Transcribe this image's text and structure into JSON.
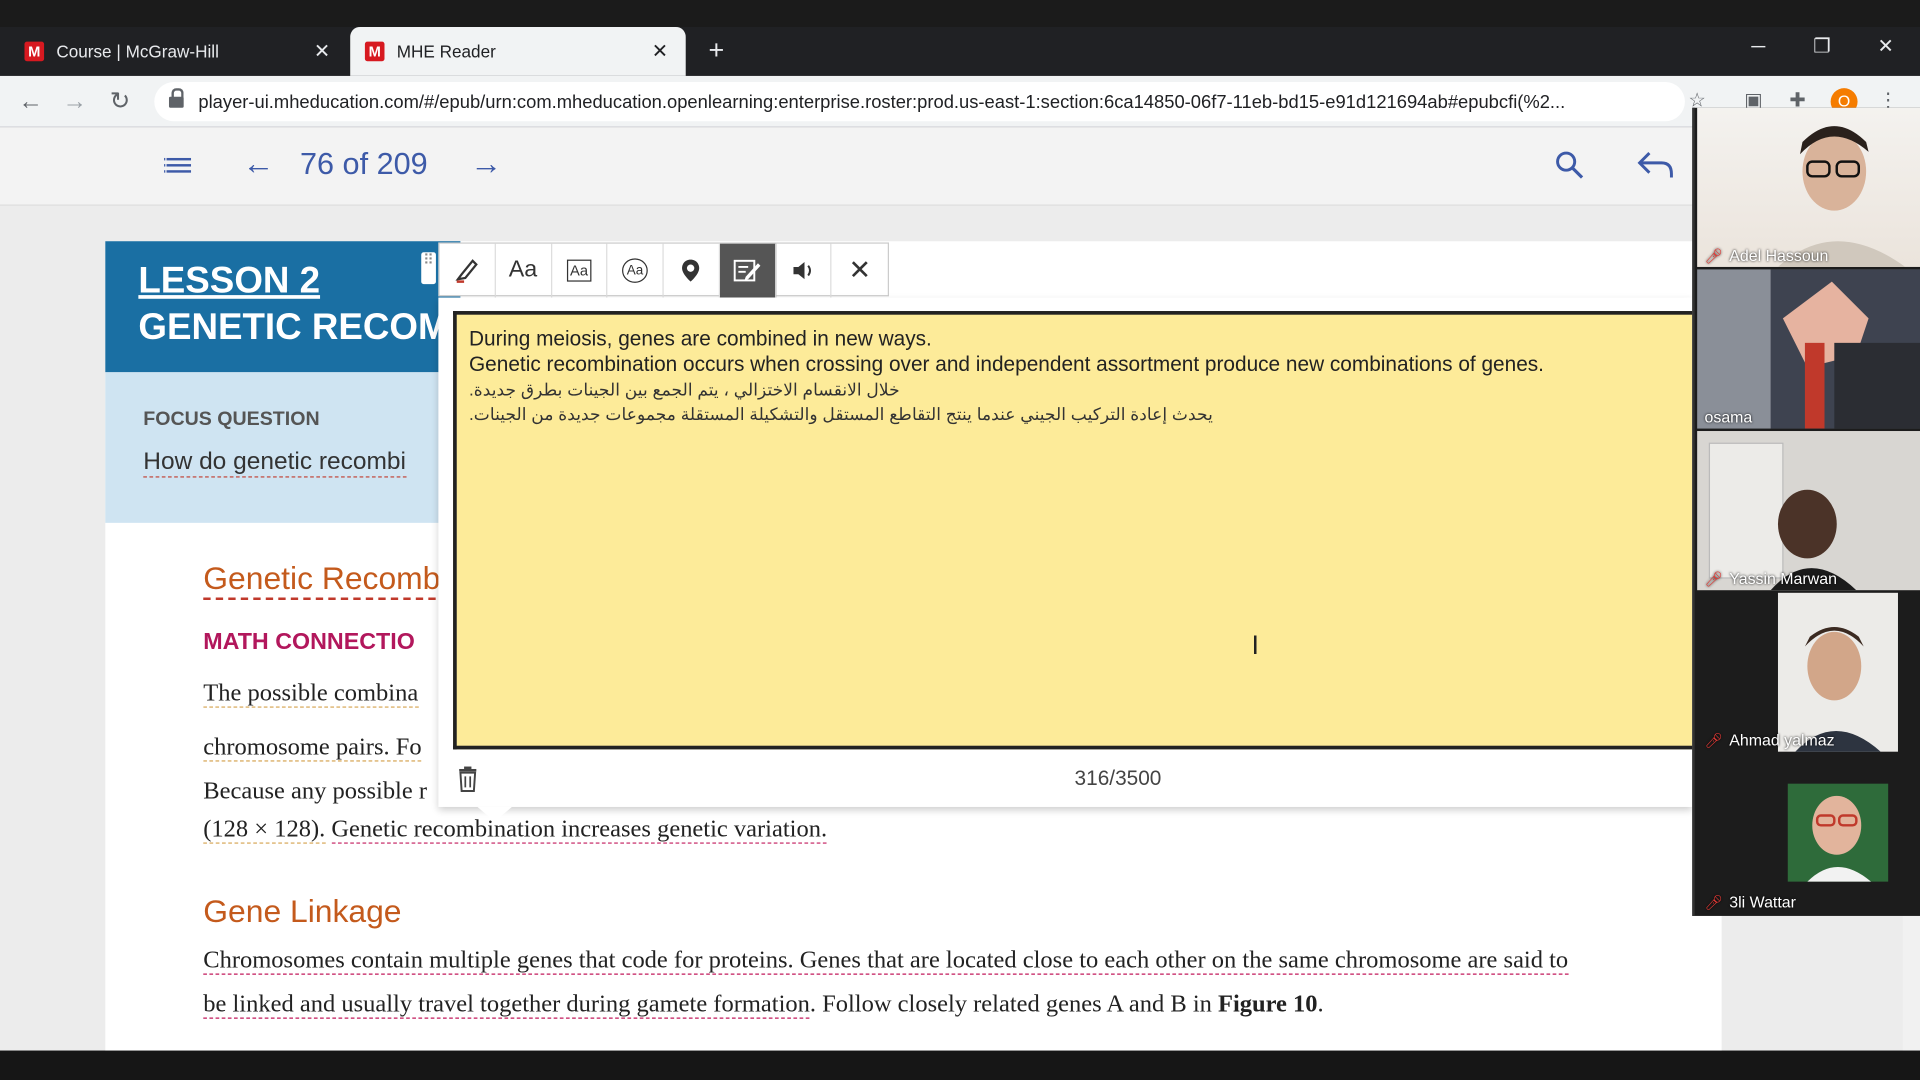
{
  "browser": {
    "tabs": [
      {
        "title": "Course | McGraw-Hill",
        "favicon": "M",
        "active": false
      },
      {
        "title": "MHE Reader",
        "favicon": "M",
        "active": true
      }
    ],
    "url": "player-ui.mheducation.com/#/epub/urn:com.mheducation.openlearning:enterprise.roster:prod.us-east-1:section:6ca14850-06f7-11eb-bd15-e91d121694ab#epubcfi(%2...",
    "profile_initial": "O",
    "new_tab_glyph": "+",
    "window_controls": {
      "minimize": "─",
      "restore": "❐",
      "close": "✕"
    }
  },
  "reader": {
    "page_indicator": "76 of 209"
  },
  "page": {
    "lesson_number": "LESSON 2",
    "lesson_title": "GENETIC RECOM",
    "focus_label": "FOCUS QUESTION",
    "focus_question": "How do genetic recombi",
    "section1_title": "Genetic Recomb",
    "math_connection": "MATH CONNECTIO",
    "para_line1": "The possible combina",
    "para_line2": "chromosome pairs. Fo",
    "para_line3": "Because any possible r",
    "para_line4a": "(128 × 128).",
    "para_line4b": "Genetic recombination increases genetic variation.",
    "section2_title": "Gene Linkage",
    "linkage_line1": "Chromosomes contain multiple genes that code for proteins. Genes that are located close to each other on the same chromosome are said to",
    "linkage_line2a": "be linked and usually travel together during gamete formation",
    "linkage_line2b": ". Follow closely related genes A and B in ",
    "linkage_line2c": "Figure 10",
    "linkage_line2d": "."
  },
  "note": {
    "lines": [
      "During meiosis, genes are combined in new ways.",
      "Genetic recombination occurs when crossing over and independent assortment produce new combinations of genes."
    ],
    "arabic_lines": [
      "خلال الانقسام الاختزالي ، يتم الجمع بين الجينات بطرق جديدة.",
      "يحدث إعادة التركيب الجيني عندما ينتج التقاطع المستقل والتشكيلة المستقلة مجموعات جديدة من الجينات."
    ],
    "char_count": "316/3500"
  },
  "participants": [
    {
      "name": "Adel Hassoun",
      "muted": true
    },
    {
      "name": "osama",
      "muted": false
    },
    {
      "name": "Yassin Marwan",
      "muted": true
    },
    {
      "name": "Ahmad yalmaz",
      "muted": true
    },
    {
      "name": "3li Wattar",
      "muted": true
    }
  ],
  "colors": {
    "accent": "#3d5aa8",
    "lesson_bg": "#1a6fa3",
    "note_bg": "#fdeb99",
    "section_heading": "#c45a1c",
    "math_heading": "#b2175c"
  }
}
